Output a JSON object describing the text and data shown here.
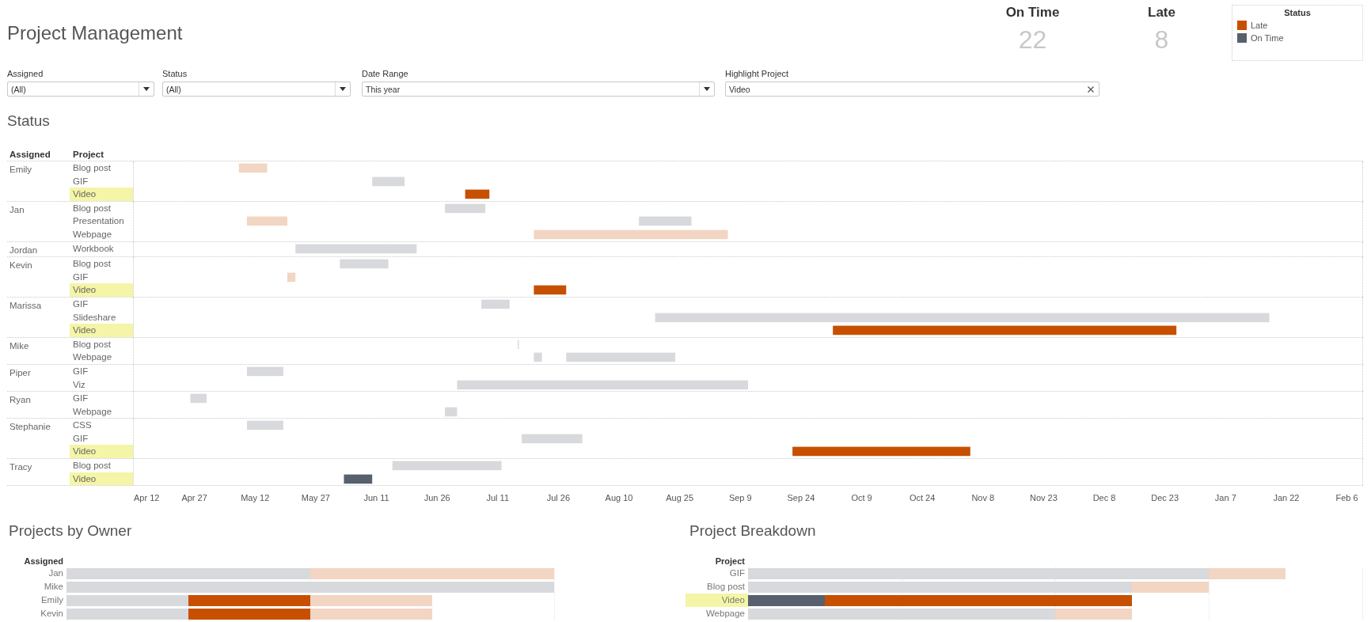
{
  "title": "Project Management",
  "kpis": [
    {
      "label": "On Time",
      "value": "22"
    },
    {
      "label": "Late",
      "value": "8"
    }
  ],
  "legend": {
    "title": "Status",
    "items": [
      {
        "label": "Late",
        "color": "#c75000"
      },
      {
        "label": "On Time",
        "color": "#57606c"
      }
    ]
  },
  "filters": [
    {
      "label": "Assigned",
      "value": "(All)",
      "kind": "dropdown"
    },
    {
      "label": "Status",
      "value": "(All)",
      "kind": "dropdown"
    },
    {
      "label": "Date Range",
      "value": "This year",
      "kind": "dropdown"
    },
    {
      "label": "Highlight Project",
      "value": "Video",
      "kind": "text"
    }
  ],
  "status_chart": {
    "title": "Status",
    "columns": [
      "Assigned",
      "Project"
    ],
    "groups": [
      {
        "assigned": "Emily",
        "projects": [
          {
            "name": "Blog post",
            "highlighted": false
          },
          {
            "name": "GIF",
            "highlighted": false
          },
          {
            "name": "Video",
            "highlighted": true
          }
        ]
      },
      {
        "assigned": "Jan",
        "projects": [
          {
            "name": "Blog post",
            "highlighted": false
          },
          {
            "name": "Presentation",
            "highlighted": false
          },
          {
            "name": "Webpage",
            "highlighted": false
          }
        ]
      },
      {
        "assigned": "Jordan",
        "projects": [
          {
            "name": "Workbook",
            "highlighted": false
          }
        ]
      },
      {
        "assigned": "Kevin",
        "projects": [
          {
            "name": "Blog post",
            "highlighted": false
          },
          {
            "name": "GIF",
            "highlighted": false
          },
          {
            "name": "Video",
            "highlighted": true
          }
        ]
      },
      {
        "assigned": "Marissa",
        "projects": [
          {
            "name": "GIF",
            "highlighted": false
          },
          {
            "name": "Slideshare",
            "highlighted": false
          },
          {
            "name": "Video",
            "highlighted": true
          }
        ]
      },
      {
        "assigned": "Mike",
        "projects": [
          {
            "name": "Blog post",
            "highlighted": false
          },
          {
            "name": "Webpage",
            "highlighted": false
          }
        ]
      },
      {
        "assigned": "Piper",
        "projects": [
          {
            "name": "GIF",
            "highlighted": false
          },
          {
            "name": "Viz",
            "highlighted": false
          }
        ]
      },
      {
        "assigned": "Ryan",
        "projects": [
          {
            "name": "GIF",
            "highlighted": false
          },
          {
            "name": "Webpage",
            "highlighted": false
          }
        ]
      },
      {
        "assigned": "Stephanie",
        "projects": [
          {
            "name": "CSS",
            "highlighted": false
          },
          {
            "name": "GIF",
            "highlighted": false
          },
          {
            "name": "Video",
            "highlighted": true
          }
        ]
      },
      {
        "assigned": "Tracy",
        "projects": [
          {
            "name": "Blog post",
            "highlighted": false
          },
          {
            "name": "Video",
            "highlighted": true
          }
        ]
      }
    ],
    "axis_labels": [
      "Apr 12",
      "Apr 27",
      "May 12",
      "May 27",
      "Jun 11",
      "Jun 26",
      "Jul 11",
      "Jul 26",
      "Aug 10",
      "Aug 25",
      "Sep 9",
      "Sep 24",
      "Oct 9",
      "Oct 24",
      "Nov 8",
      "Nov 23",
      "Dec 8",
      "Dec 23",
      "Jan 7",
      "Jan 22",
      "Feb 6"
    ]
  },
  "projects_by_owner": {
    "title": "Projects by Owner",
    "axis_title": "Assigned",
    "rows": [
      {
        "label": "Jan",
        "highlighted": false
      },
      {
        "label": "Mike",
        "highlighted": false
      },
      {
        "label": "Emily",
        "highlighted": false
      },
      {
        "label": "Kevin",
        "highlighted": false
      }
    ]
  },
  "project_breakdown": {
    "title": "Project Breakdown",
    "axis_title": "Project",
    "rows": [
      {
        "label": "GIF",
        "highlighted": false
      },
      {
        "label": "Blog post",
        "highlighted": false
      },
      {
        "label": "Video",
        "highlighted": true
      },
      {
        "label": "Webpage",
        "highlighted": false
      }
    ]
  }
}
